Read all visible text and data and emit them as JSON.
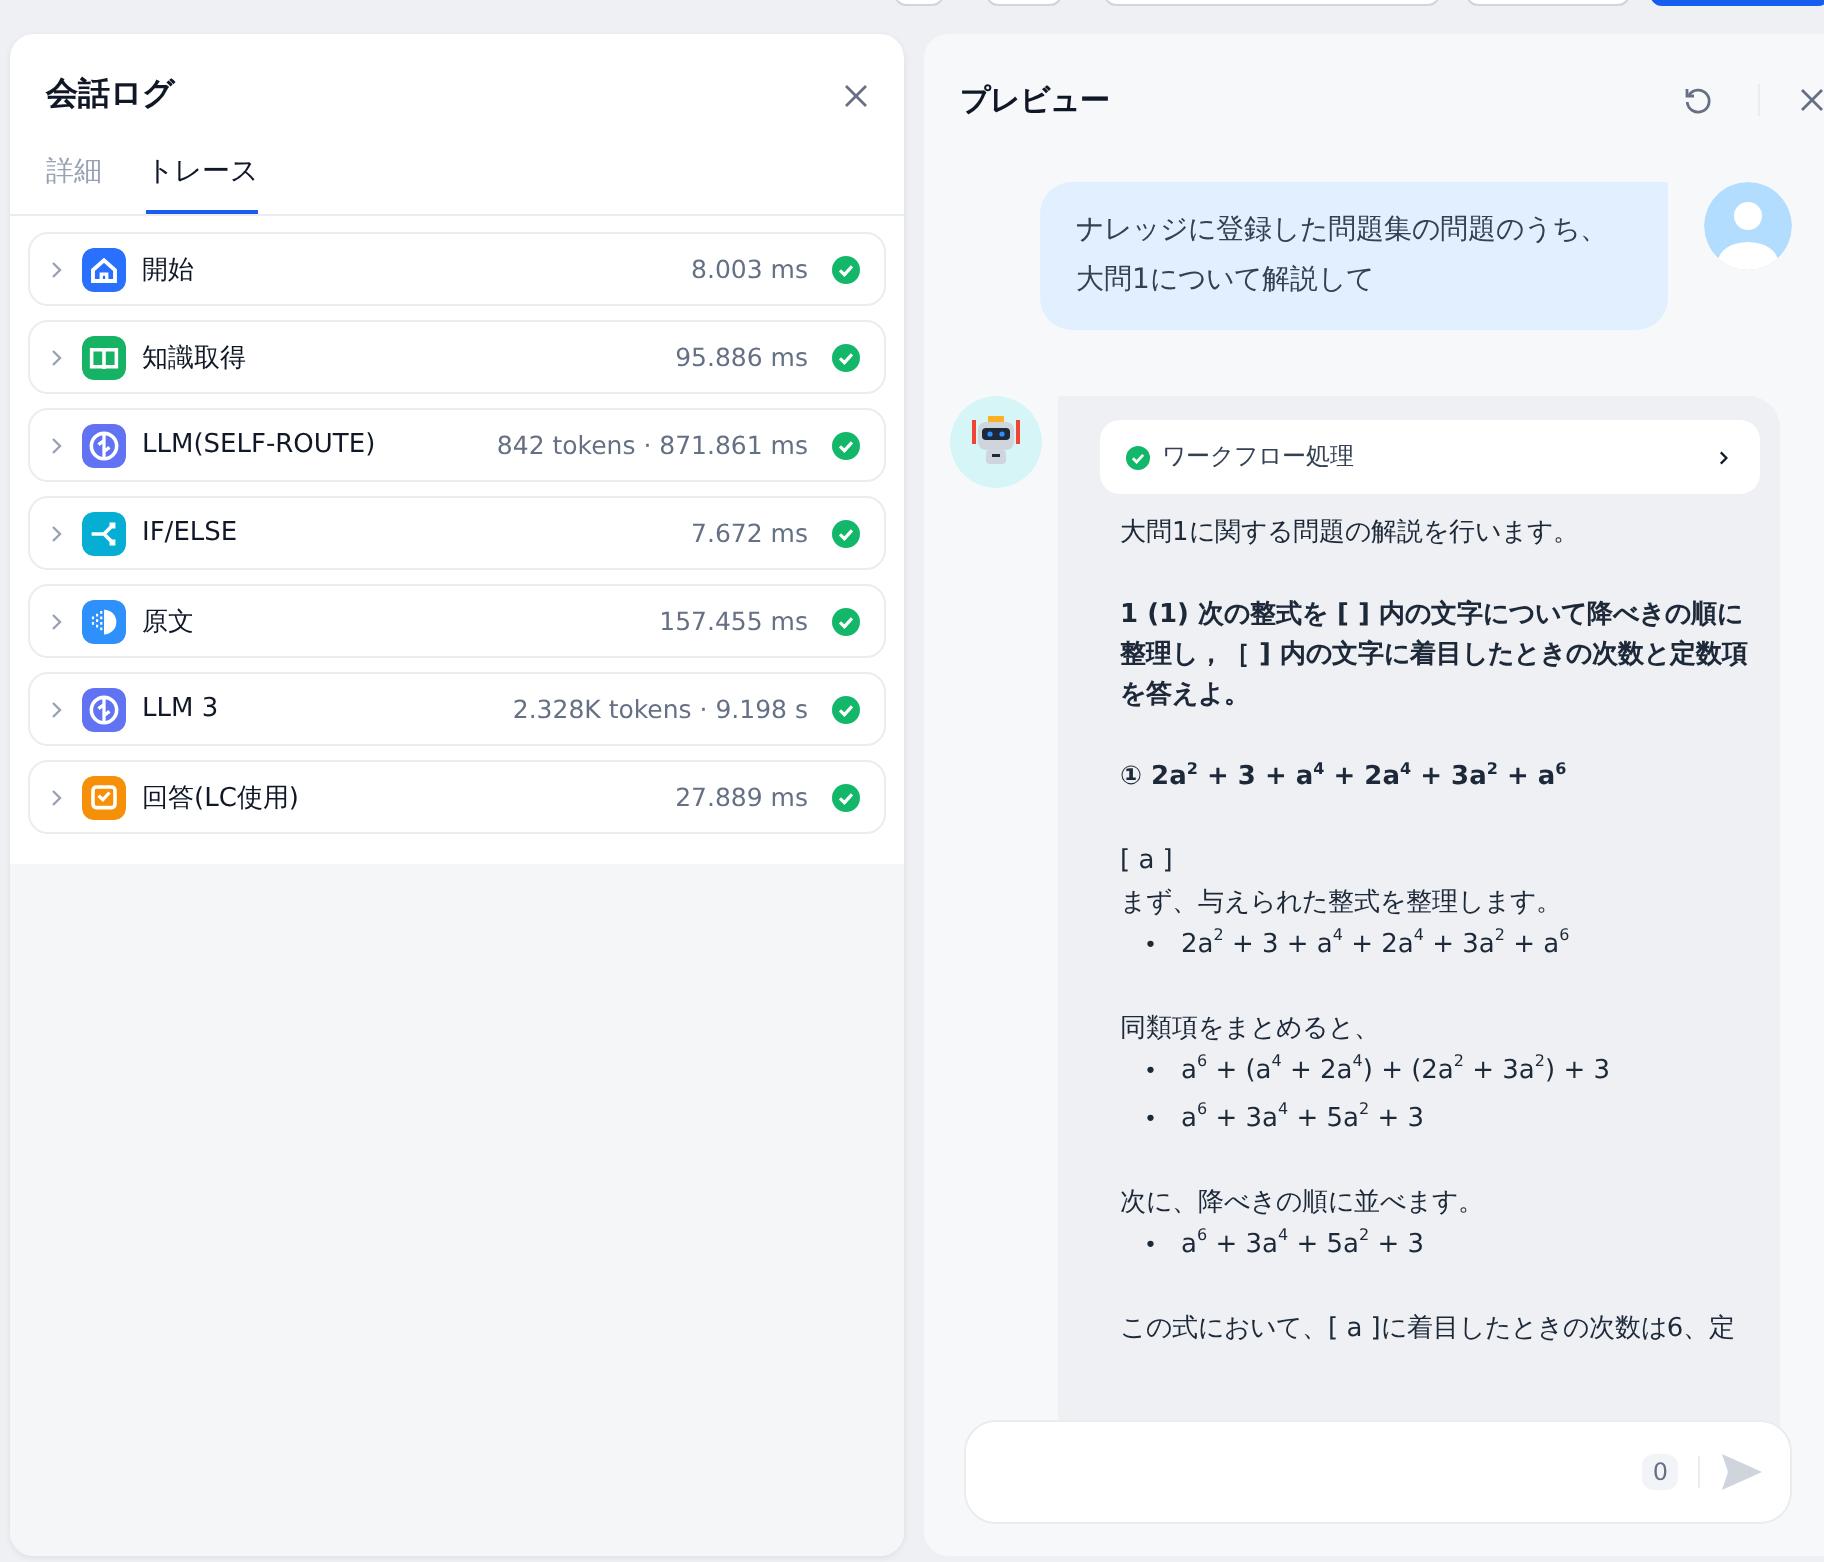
{
  "toolbar_buttons": [
    {
      "kind": "plain"
    },
    {
      "kind": "plain"
    },
    {
      "kind": "plain"
    },
    {
      "kind": "plain"
    },
    {
      "kind": "primary"
    }
  ],
  "log_panel": {
    "title": "会話ログ",
    "tabs": [
      {
        "label": "詳細",
        "selected": false
      },
      {
        "label": "トレース",
        "selected": true
      }
    ],
    "trace": [
      {
        "kind": "start",
        "label": "開始",
        "metric": "8.003 ms"
      },
      {
        "kind": "knowledge",
        "label": "知識取得",
        "metric": "95.886 ms"
      },
      {
        "kind": "llm",
        "label": "LLM(SELF-ROUTE)",
        "metric": "842 tokens · 871.861 ms"
      },
      {
        "kind": "ifelse",
        "label": "IF/ELSE",
        "metric": "7.672 ms"
      },
      {
        "kind": "template",
        "label": "原文",
        "metric": "157.455 ms"
      },
      {
        "kind": "llm",
        "label": "LLM 3",
        "metric": "2.328K tokens · 9.198 s"
      },
      {
        "kind": "answer",
        "label": "回答(LC使用)",
        "metric": "27.889 ms"
      }
    ]
  },
  "preview": {
    "title": "プレビュー",
    "user_message": "ナレッジに登録した問題集の問題のうち、大問1について解説して",
    "workflow": {
      "label": "ワークフロー処理"
    },
    "answer": [
      {
        "kind": "text",
        "text": "大問1に関する問題の解説を行います。"
      },
      {
        "kind": "bold",
        "text": "1 (1) 次の整式を [ ] 内の文字について降べきの順に整理し，［ ] 内の文字に着目したときの次数と定数項を答えよ。"
      },
      {
        "kind": "bold",
        "text": "① 2a$^{2}$ + 3 + a$^{4}$ + 2a$^{4}$ + 3a$^{2}$ + a$^{6}$"
      },
      {
        "kind": "label",
        "text": "[ a ]"
      },
      {
        "kind": "lead",
        "text": "まず、与えられた整式を整理します。"
      },
      {
        "kind": "list",
        "items": [
          {
            "marker": "•",
            "text": "2a$^{2}$ + 3 + a$^{4}$ + 2a$^{4}$ + 3a$^{2}$ + a$^{6}$"
          }
        ]
      },
      {
        "kind": "lead",
        "text": "同類項をまとめると、"
      },
      {
        "kind": "list",
        "items": [
          {
            "marker": "•",
            "text": "a$^{6}$ + (a$^{4}$ + 2a$^{4}$) + (2a$^{2}$ + 3a$^{2}$) + 3"
          },
          {
            "marker": "•",
            "text": "a$^{6}$ + 3a$^{4}$ + 5a$^{2}$ + 3"
          }
        ]
      },
      {
        "kind": "lead",
        "text": "次に、降べきの順に並べます。"
      },
      {
        "kind": "list",
        "items": [
          {
            "marker": "•",
            "text": "a$^{6}$ + 3a$^{4}$ + 5a$^{2}$ + 3"
          }
        ]
      },
      {
        "kind": "text",
        "text": "この式において、[ a ]に着目したときの次数は6、定"
      }
    ],
    "input": {
      "char_count": "0"
    }
  }
}
